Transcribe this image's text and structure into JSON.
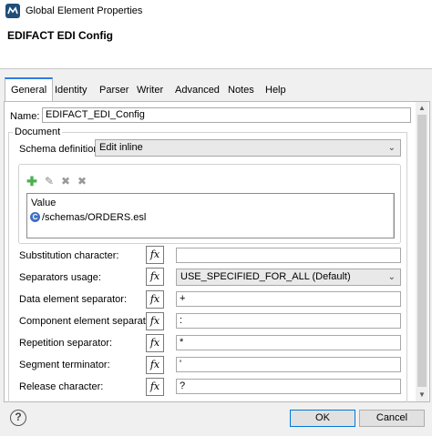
{
  "window": {
    "title": "Global Element Properties",
    "app_icon": "mule-studio-icon"
  },
  "header": {
    "title": "EDIFACT EDI Config"
  },
  "tabs": [
    {
      "label": "General",
      "active": true
    },
    {
      "label": "Identity"
    },
    {
      "label": "Parser"
    },
    {
      "label": "Writer"
    },
    {
      "label": "Advanced"
    },
    {
      "label": "Notes"
    },
    {
      "label": "Help"
    }
  ],
  "general": {
    "name_label": "Name:",
    "name_value": "EDIFACT_EDI_Config",
    "document_group": "Document",
    "schema_label": "Schema definitions",
    "schema_mode": "Edit inline",
    "toolbar_icons": [
      "add-icon",
      "edit-icon",
      "delete-icon",
      "delete-all-icon"
    ],
    "list_header": "Value",
    "list_items": [
      "/schemas/ORDERS.esl"
    ]
  },
  "fields": [
    {
      "label": "Substitution character:",
      "value": "",
      "fx": "fx"
    },
    {
      "label": "Separators usage:",
      "value": "USE_SPECIFIED_FOR_ALL (Default)",
      "fx": "fx",
      "type": "select"
    },
    {
      "label": "Data element separator:",
      "value": "+",
      "fx": "fx"
    },
    {
      "label": "Component element separator:",
      "value": ":",
      "fx": "fx"
    },
    {
      "label": "Repetition separator:",
      "value": "*",
      "fx": "fx"
    },
    {
      "label": "Segment terminator:",
      "value": "'",
      "fx": "fx"
    },
    {
      "label": "Release character:",
      "value": "?",
      "fx": "fx"
    }
  ],
  "footer": {
    "help_symbol": "?",
    "ok_label": "OK",
    "cancel_label": "Cancel"
  },
  "colors": {
    "accent": "#2d7be3",
    "add": "#4caf50",
    "schema_icon": "#3f6fc9"
  }
}
